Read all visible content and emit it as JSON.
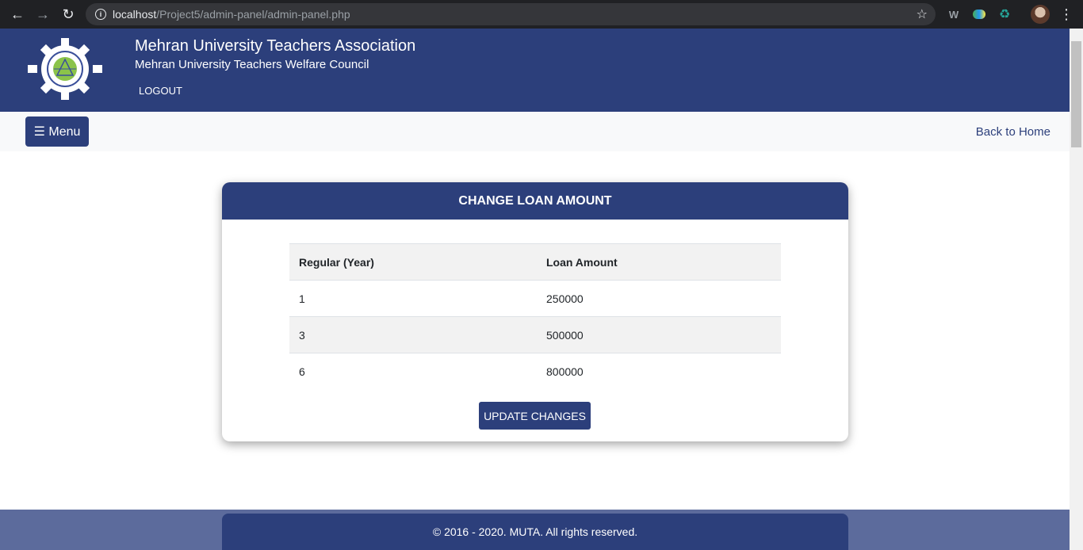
{
  "browser": {
    "url_host": "localhost",
    "url_path": "/Project5/admin-panel/admin-panel.php"
  },
  "header": {
    "title": "Mehran University Teachers Association",
    "subtitle": "Mehran University Teachers Welfare Council",
    "logout_label": "LOGOUT"
  },
  "navbar": {
    "menu_label": "☰ Menu",
    "back_home_label": "Back to Home"
  },
  "card": {
    "title": "CHANGE LOAN AMOUNT",
    "columns": [
      "Regular (Year)",
      "Loan Amount"
    ],
    "rows": [
      {
        "year": "1",
        "amount": "250000"
      },
      {
        "year": "3",
        "amount": "500000"
      },
      {
        "year": "6",
        "amount": "800000"
      }
    ],
    "update_label": "UPDATE CHANGES"
  },
  "footer": {
    "text": "© 2016 - 2020. MUTA. All rights reserved."
  },
  "colors": {
    "primary": "#2c3f7b",
    "footer_band": "#5c6b9c",
    "navbar_bg": "#f8f9fa"
  }
}
